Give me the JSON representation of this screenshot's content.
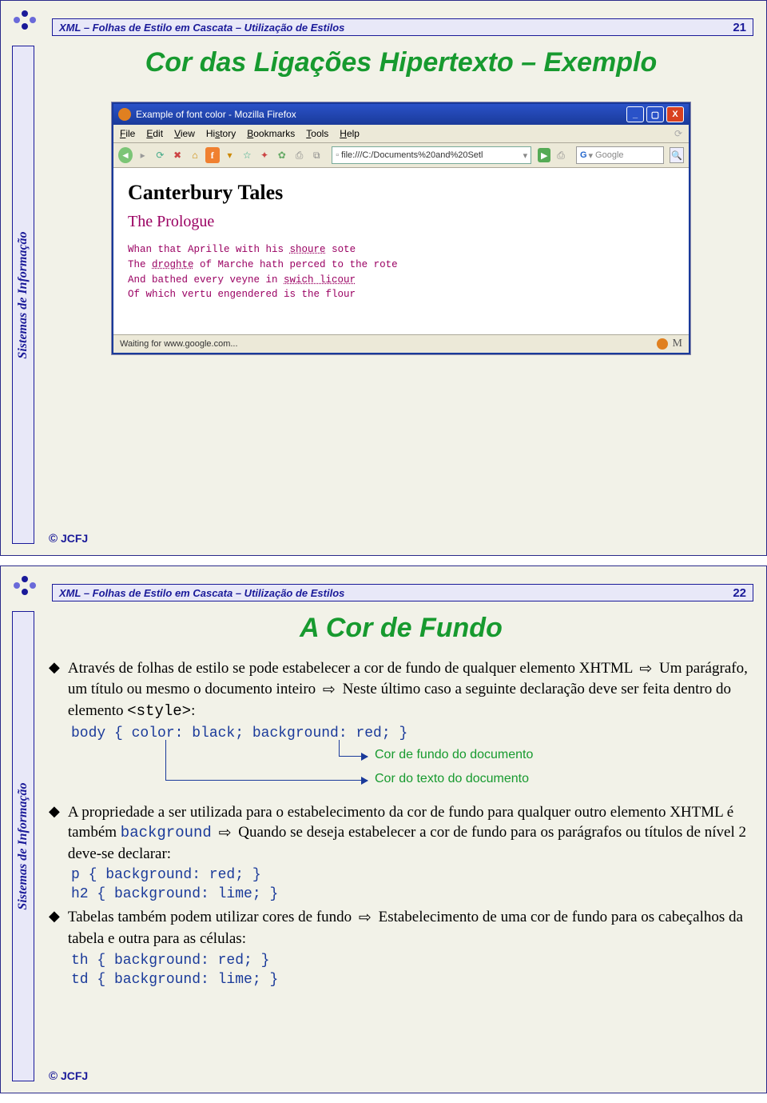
{
  "header_title": "XML – Folhas de Estilo em Cascata – Utilização de Estilos",
  "sidebar_label": "Sistemas de Informação",
  "footer": "JCFJ",
  "copyright": "©",
  "slide1": {
    "number": "21",
    "title": "Cor das Ligações Hipertexto – Exemplo",
    "browser": {
      "window_title": "Example of font color - Mozilla Firefox",
      "menus": {
        "file": "File",
        "edit": "Edit",
        "view": "View",
        "history": "History",
        "bookmarks": "Bookmarks",
        "tools": "Tools",
        "help": "Help"
      },
      "address": "file:///C:/Documents%20and%20Setl",
      "search_placeholder": "Google",
      "search_engine_prefix": "G",
      "body": {
        "h2": "Canterbury Tales",
        "h3": "The Prologue",
        "lines": [
          {
            "pre": "Whan that Aprille with his ",
            "u": "shoure",
            "post": " sote"
          },
          {
            "pre": "    The ",
            "u": "droghte",
            "post": " of Marche hath perced to the rote"
          },
          {
            "pre": "    And bathed every veyne in ",
            "u": "swich licour",
            "post": ""
          },
          {
            "pre": "    Of which vertu engendered is the flour",
            "u": "",
            "post": ""
          }
        ]
      },
      "status": "Waiting for www.google.com..."
    }
  },
  "slide2": {
    "number": "22",
    "title": "A Cor de Fundo",
    "b1_text": "Através de folhas de estilo se pode estabelecer a cor de fundo de qualquer elemento XHTML ⇨ Um parágrafo, um título ou mesmo o documento inteiro ⇨ Neste último caso a seguinte declaração deve ser feita dentro do elemento ",
    "style_tag": "<style>",
    "code1": "body { color: black; background: red; }",
    "ann1": "Cor de fundo do documento",
    "ann2": "Cor do texto do documento",
    "b2_a": "A propriedade a ser utilizada para o estabelecimento da cor de fundo para qualquer outro elemento XHTML é também ",
    "b2_code": "background",
    "b2_b": " ⇨ Quando se deseja estabelecer a cor de fundo para os parágrafos ou títulos de nível 2 deve-se declarar:",
    "code2a": "p { background: red; }",
    "code2b": "h2 { background: lime; }",
    "b3": "Tabelas também podem utilizar cores de fundo ⇨ Estabelecimento de uma cor de fundo para os cabeçalhos da tabela e outra para as células:",
    "code3a": "th { background: red; }",
    "code3b": "td { background: lime; }"
  }
}
